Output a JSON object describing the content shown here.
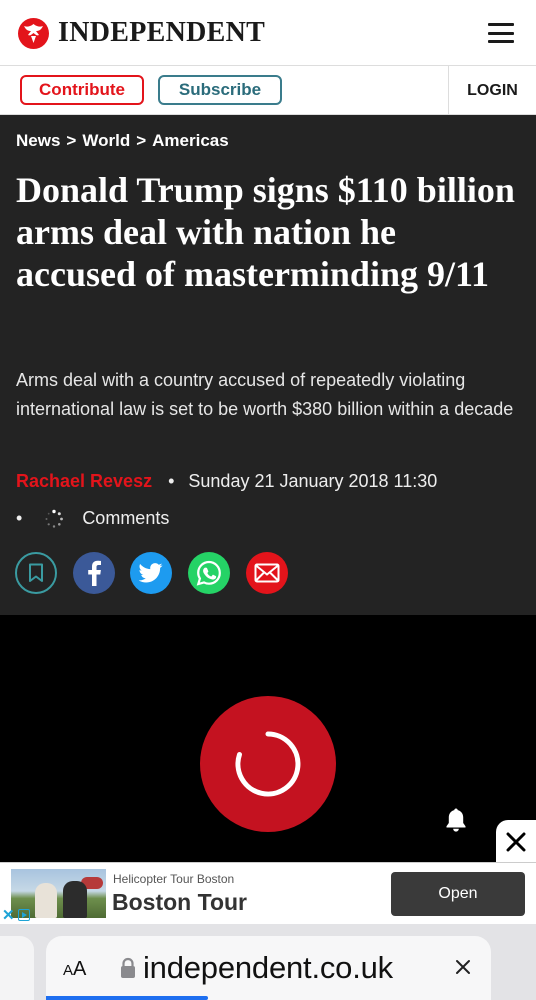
{
  "header": {
    "logo_text": "INDEPENDENT",
    "menu_icon": "hamburger-menu-icon"
  },
  "actions": {
    "contribute_label": "Contribute",
    "subscribe_label": "Subscribe",
    "login_label": "LOGIN"
  },
  "breadcrumb": {
    "items": [
      "News",
      "World",
      "Americas"
    ],
    "separator": ">"
  },
  "article": {
    "headline": "Donald Trump signs $110 billion arms deal with nation he accused of masterminding 9/11",
    "standfirst": "Arms deal with a country accused of repeatedly violating international law is set to be worth $380 billion within a decade",
    "author": "Rachael Revesz",
    "bullet": "•",
    "date": "Sunday 21 January 2018 11:30",
    "comments_label": "Comments"
  },
  "share_icons": [
    "bookmark-icon",
    "facebook-icon",
    "twitter-icon",
    "whatsapp-icon",
    "email-icon"
  ],
  "video": {
    "state_icon": "loading-spinner-icon"
  },
  "ad": {
    "small_text": "Helicopter Tour Boston",
    "big_text": "Boston Tour",
    "button_label": "Open"
  },
  "browser": {
    "text_size_label": "AA",
    "url": "independent.co.uk",
    "page_load_progress": 0.33
  },
  "colors": {
    "brand_red": "#e3141b",
    "article_bg": "#232323",
    "subscribe_teal": "#2b6c7b",
    "facebook": "#3b5998",
    "twitter": "#1d9bf0",
    "whatsapp": "#25d366"
  }
}
